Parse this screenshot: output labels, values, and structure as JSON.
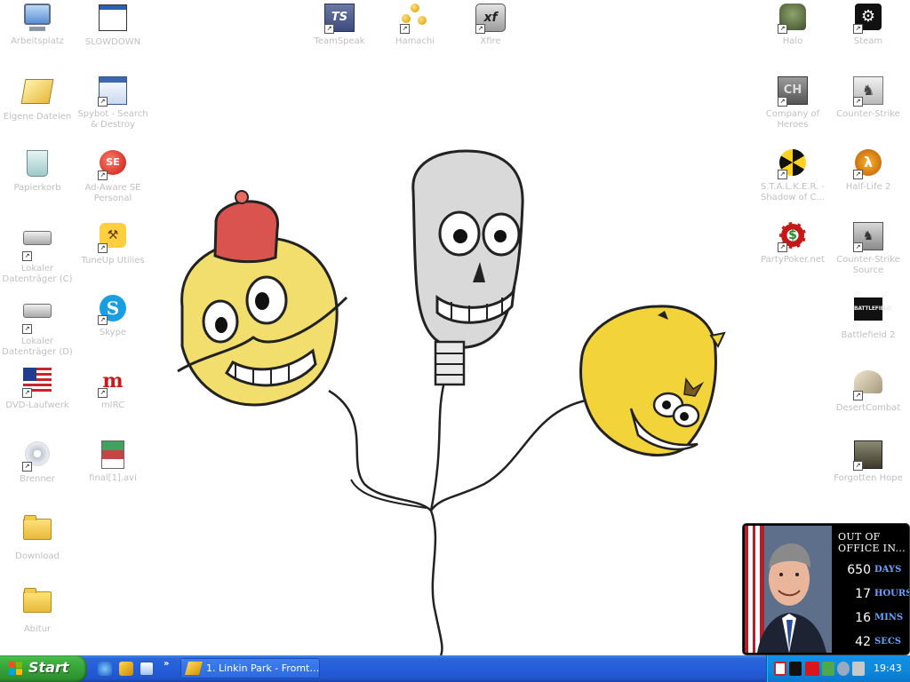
{
  "desktop": {
    "icons_left": [
      {
        "label": "Arbeitsplatz",
        "icon": "my-computer-icon",
        "shortcut": false
      },
      {
        "label": "Eigene Dateien",
        "icon": "my-documents-icon",
        "shortcut": false
      },
      {
        "label": "Papierkorb",
        "icon": "recycle-bin-icon",
        "shortcut": false
      },
      {
        "label": "Lokaler Datenträger (C)",
        "icon": "hard-drive-icon",
        "shortcut": true
      },
      {
        "label": "Lokaler Datenträger (D)",
        "icon": "hard-drive-icon",
        "shortcut": true
      },
      {
        "label": "DVD-Laufwerk",
        "icon": "dvd-drive-icon",
        "shortcut": true
      },
      {
        "label": "Brenner",
        "icon": "cd-burner-icon",
        "shortcut": true
      },
      {
        "label": "Download",
        "icon": "folder-icon",
        "shortcut": false
      },
      {
        "label": "Abitur",
        "icon": "folder-icon",
        "shortcut": false
      }
    ],
    "icons_left2": [
      {
        "label": "SLOWDOWN",
        "icon": "window-icon",
        "shortcut": false
      },
      {
        "label": "Spybot - Search & Destroy",
        "icon": "spybot-icon",
        "shortcut": true
      },
      {
        "label": "Ad-Aware SE Personal",
        "icon": "adaware-icon",
        "shortcut": true,
        "glyph": "SE"
      },
      {
        "label": "TuneUp Utilies",
        "icon": "tuneup-icon",
        "shortcut": true,
        "glyph": "⚒"
      },
      {
        "label": "Skype",
        "icon": "skype-icon",
        "shortcut": true,
        "glyph": "S"
      },
      {
        "label": "mIRC",
        "icon": "mirc-icon",
        "shortcut": true,
        "glyph": "m"
      },
      {
        "label": "final[1].avi",
        "icon": "avi-file-icon",
        "shortcut": false
      }
    ],
    "icons_top": [
      {
        "label": "TeamSpeak",
        "icon": "teamspeak-icon",
        "shortcut": true,
        "glyph": "TS"
      },
      {
        "label": "Hamachi",
        "icon": "hamachi-icon",
        "shortcut": true
      },
      {
        "label": "Xfire",
        "icon": "xfire-icon",
        "shortcut": true,
        "glyph": "xf"
      }
    ],
    "icons_right1": [
      {
        "label": "Halo",
        "icon": "halo-icon",
        "shortcut": true
      },
      {
        "label": "Company of Heroes",
        "icon": "company-of-heroes-icon",
        "shortcut": true,
        "glyph": "CH"
      },
      {
        "label": "S.T.A.L.K.E.R. - Shadow of C...",
        "icon": "stalker-radiation-icon",
        "shortcut": true
      },
      {
        "label": "PartyPoker.net",
        "icon": "poker-chip-icon",
        "shortcut": true,
        "glyph": "$"
      }
    ],
    "icons_right2": [
      {
        "label": "Steam",
        "icon": "steam-icon",
        "shortcut": true,
        "glyph": "⚙"
      },
      {
        "label": "Counter-Strike",
        "icon": "counter-strike-icon",
        "shortcut": true,
        "glyph": "♞"
      },
      {
        "label": "Half-Life 2",
        "icon": "half-life-2-icon",
        "shortcut": true,
        "glyph": "λ"
      },
      {
        "label": "Counter-Strike Source",
        "icon": "counter-strike-source-icon",
        "shortcut": true,
        "glyph": "♞"
      },
      {
        "label": "Battlefield 2",
        "icon": "battlefield-2-icon",
        "shortcut": false,
        "glyph": "BATTLEFIELD"
      },
      {
        "label": "DesertCombat",
        "icon": "desertcombat-icon",
        "shortcut": true
      },
      {
        "label": "Forgotten Hope",
        "icon": "forgotten-hope-icon",
        "shortcut": true
      }
    ]
  },
  "widget": {
    "title": "OUT OF OFFICE IN...",
    "rows": [
      {
        "value": "650",
        "unit": "DAYS"
      },
      {
        "value": "17",
        "unit": "HOURS"
      },
      {
        "value": "16",
        "unit": "MINS"
      },
      {
        "value": "42",
        "unit": "SECS"
      }
    ]
  },
  "taskbar": {
    "start_label": "Start",
    "quicklaunch_more": "»",
    "task_label": "1. Linkin Park - Fromt…",
    "clock": "19:43"
  },
  "colors": {
    "taskbar": "#245edb",
    "start_button": "#39a93b",
    "tray": "#0c8ade",
    "icon_label": "#c0c0c0",
    "widget_unit": "#6aa3ff"
  }
}
